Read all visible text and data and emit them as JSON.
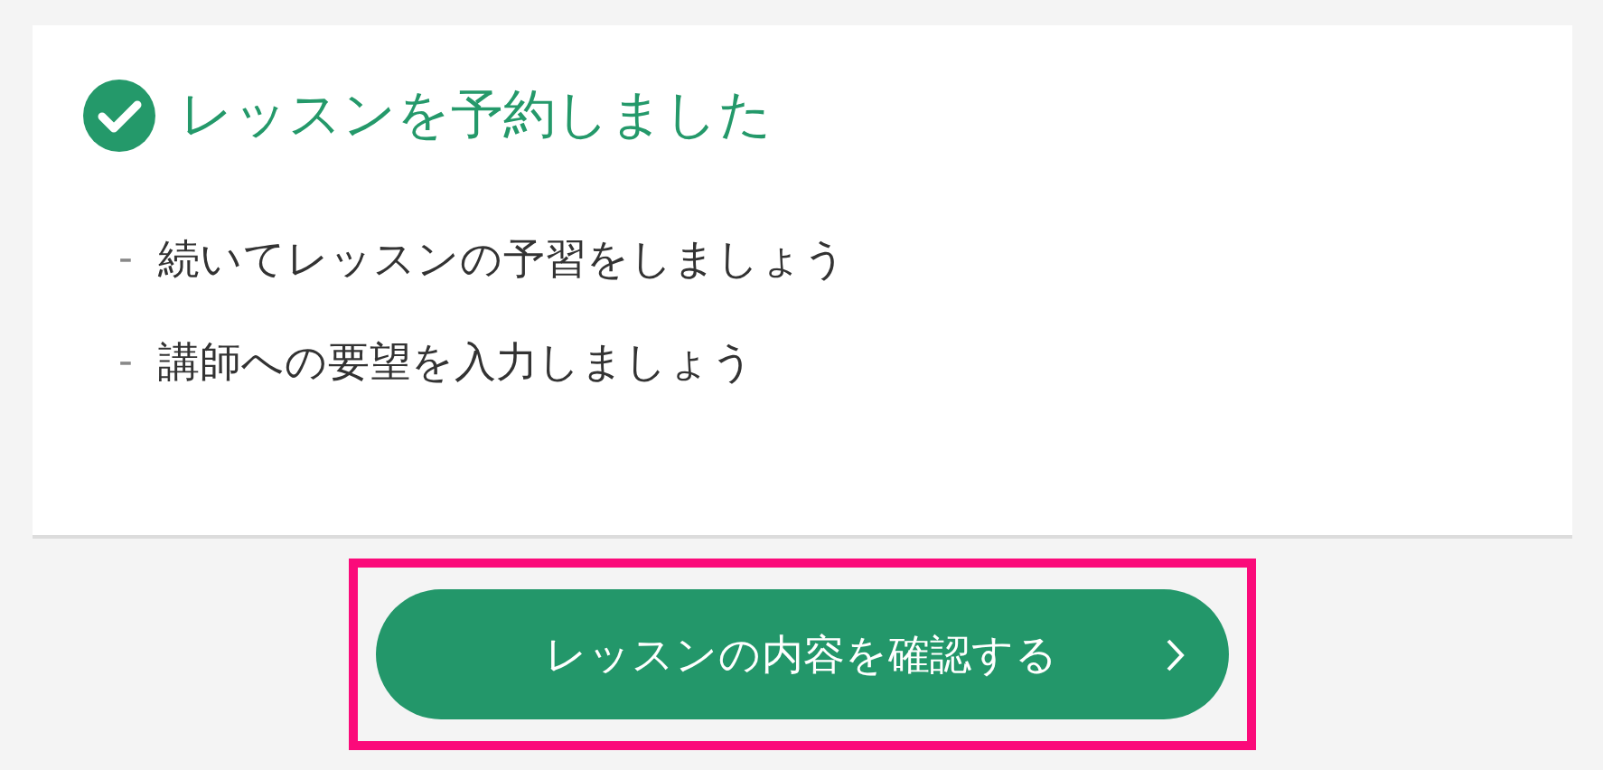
{
  "card": {
    "title": "レッスンを予約しました",
    "items": [
      {
        "bullet": "-",
        "text": "続いてレッスンの予習をしましょう"
      },
      {
        "bullet": "-",
        "text": "講師への要望を入力しましょう"
      }
    ]
  },
  "button": {
    "label": "レッスンの内容を確認する",
    "highlighted": true
  }
}
